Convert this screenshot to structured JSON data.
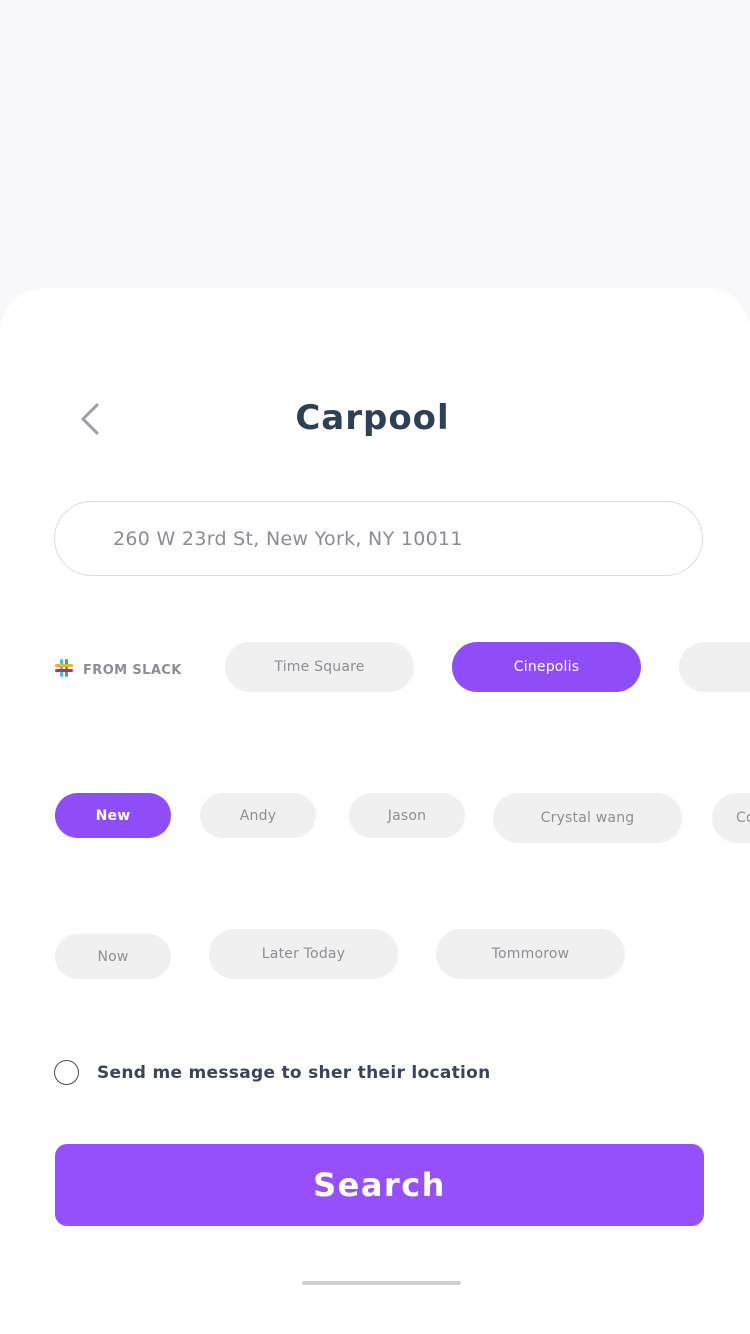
{
  "header": {
    "title": "Carpool"
  },
  "address": {
    "value": "260 W 23rd St, New York, NY 10011"
  },
  "slack": {
    "label": "FROM SLACK"
  },
  "places": [
    {
      "label": "Time Square",
      "active": false
    },
    {
      "label": "Cinepolis",
      "active": true
    },
    {
      "label": "",
      "active": false
    }
  ],
  "people": [
    {
      "label": "New",
      "active": true
    },
    {
      "label": "Andy",
      "active": false
    },
    {
      "label": "Jason",
      "active": false
    },
    {
      "label": "Crystal wang",
      "active": false
    },
    {
      "label": "Co",
      "active": false
    }
  ],
  "times": [
    {
      "label": "Now",
      "active": false
    },
    {
      "label": "Later Today",
      "active": false
    },
    {
      "label": "Tommorow",
      "active": false
    }
  ],
  "notify": {
    "label": "Send me message to sher their location",
    "checked": false
  },
  "search": {
    "label": "Search"
  },
  "colors": {
    "accent": "#9550fb",
    "chip_bg": "#f0f0f1",
    "title": "#2f3f56"
  }
}
